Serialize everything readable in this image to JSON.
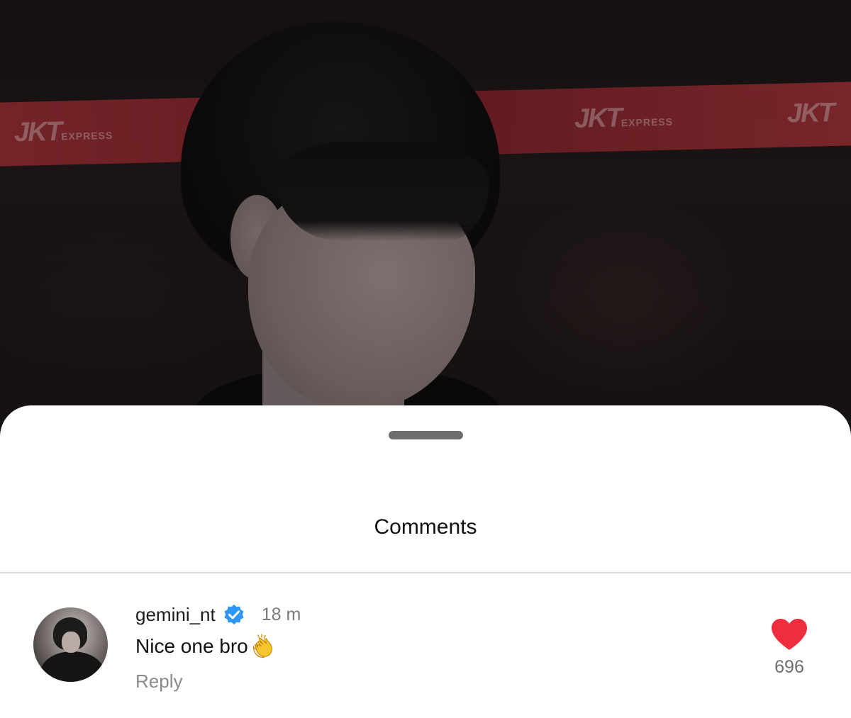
{
  "background": {
    "banner_logo": "JKT",
    "banner_logo_sub": "EXPRESS"
  },
  "sheet": {
    "title": "Comments"
  },
  "comments": [
    {
      "username": "gemini_nt",
      "verified": true,
      "time": "18 m",
      "text": "Nice one bro",
      "emoji_icon": "clapping-hands-icon",
      "reply_label": "Reply",
      "like_count": "696",
      "liked": true
    }
  ],
  "colors": {
    "like_red": "#ee2d3f",
    "verified_blue": "#2f96f3",
    "handle_gray": "#6e6e6e"
  }
}
